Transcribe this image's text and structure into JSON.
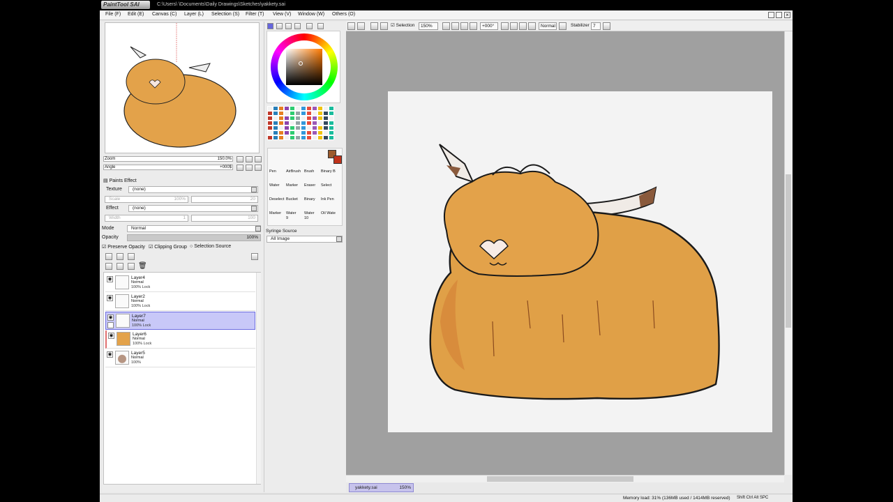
{
  "app": {
    "logo_text": "PaintTool SAI",
    "path": "C:\\Users\\            \\Documents\\Daily Drawings\\Sketches\\yakkety.sai"
  },
  "menu": [
    "File (F)",
    "Edit (E)",
    "Canvas (C)",
    "Layer (L)",
    "Selection (S)",
    "Filter (T)",
    "View (V)",
    "Window (W)",
    "Others (O)"
  ],
  "toolbar": {
    "selection_label": "Selection",
    "selection_checked": true,
    "zoom": "150%",
    "rotation": "+000°",
    "blend": "Normal",
    "stabilizer_label": "Stabilizer",
    "stabilizer_value": "7"
  },
  "navigator": {
    "zoom_label": "Zoom",
    "zoom_value": "150.0%",
    "angle_label": "Angle",
    "angle_value": "+000$"
  },
  "paints_effect": {
    "title": "Paints Effect",
    "texture_label": "Texture",
    "texture_value": "(none)",
    "texture_scale": "Scale",
    "texture_scale_value": "100%",
    "texture_strength_value": "20",
    "effect_label": "Effect",
    "effect_value": "(none)",
    "effect_width": "Width",
    "effect_width_value": "1",
    "effect_strength_value": "100"
  },
  "layer_props": {
    "mode_label": "Mode",
    "mode_value": "Normal",
    "opacity_label": "Opacity",
    "opacity_value": "100%",
    "opacity_fraction": 1.0,
    "preserve_opacity": "Preserve Opacity",
    "clipping_group": "Clipping Group",
    "selection_source": "Selection Source"
  },
  "layers": [
    {
      "name": "Layer4",
      "mode": "Normal",
      "opacity": "100% Lock",
      "selected": false
    },
    {
      "name": "Layer2",
      "mode": "Normal",
      "opacity": "100% Lock",
      "selected": false
    },
    {
      "name": "Layer7",
      "mode": "Normal",
      "opacity": "100% Lock",
      "selected": true
    },
    {
      "name": "Layer6",
      "mode": "Normal",
      "opacity": "100% Lock",
      "selected": false
    },
    {
      "name": "Layer5",
      "mode": "Normal",
      "opacity": "100%",
      "selected": false
    }
  ],
  "tools": {
    "row1": [
      "Pen",
      "AirBrush",
      "Brush",
      "Binary B"
    ],
    "row2": [
      "Water",
      "Marker",
      "Eraser",
      "Select"
    ],
    "row3": [
      "Deselect",
      "Bucket",
      "Binary",
      "Ink Pen"
    ],
    "row4": [
      "Marker",
      "Water",
      "Water",
      "Oil Wate"
    ],
    "row4_sizes": [
      "",
      "9",
      "10",
      ""
    ],
    "syringe_label": "Syringe Source",
    "syringe_value": "All Image"
  },
  "colors": {
    "foreground": "#9c5a2c",
    "background": "#c0321a",
    "accent_tab": "#c7c3ec",
    "fur": "#e3a24a"
  },
  "document_tab": {
    "name": "yakkety.sai",
    "zoom": "150%"
  },
  "status": {
    "memory": "Memory load: 31% (136MB used / 1414MB reserved)",
    "keys": "Shift Ctrl Alt SPC"
  }
}
